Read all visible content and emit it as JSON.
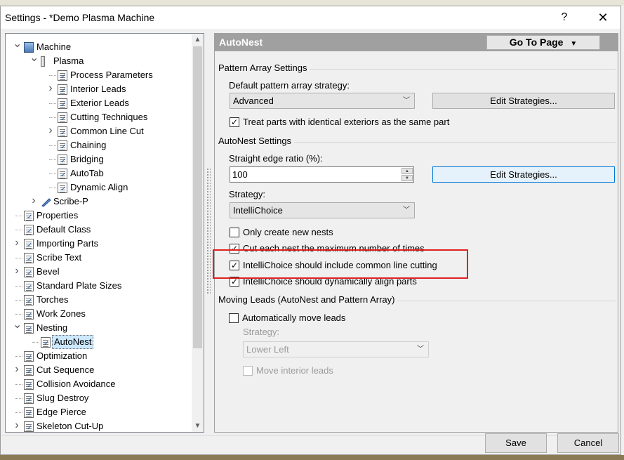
{
  "window": {
    "title": "Settings - *Demo Plasma Machine",
    "help_label": "?",
    "close_label": "✕"
  },
  "tree": {
    "items": [
      {
        "label": "Machine",
        "level": 0,
        "expander": "down",
        "icon": "machine-icon"
      },
      {
        "label": "Plasma",
        "level": 1,
        "expander": "down",
        "icon": "plasma-torch-icon"
      },
      {
        "label": "Process Parameters",
        "level": 2,
        "expander": "",
        "icon": "page-icon"
      },
      {
        "label": "Interior Leads",
        "level": 2,
        "expander": "right",
        "icon": "page-icon"
      },
      {
        "label": "Exterior Leads",
        "level": 2,
        "expander": "",
        "icon": "page-icon"
      },
      {
        "label": "Cutting Techniques",
        "level": 2,
        "expander": "",
        "icon": "page-icon"
      },
      {
        "label": "Common Line Cut",
        "level": 2,
        "expander": "right",
        "icon": "page-icon"
      },
      {
        "label": "Chaining",
        "level": 2,
        "expander": "",
        "icon": "page-icon"
      },
      {
        "label": "Bridging",
        "level": 2,
        "expander": "",
        "icon": "page-icon"
      },
      {
        "label": "AutoTab",
        "level": 2,
        "expander": "",
        "icon": "page-icon"
      },
      {
        "label": "Dynamic Align",
        "level": 2,
        "expander": "",
        "icon": "page-icon"
      },
      {
        "label": "Scribe-P",
        "level": 1,
        "expander": "right",
        "icon": "scribe-pen-icon"
      },
      {
        "label": "Properties",
        "level": 0,
        "expander": "",
        "icon": "page-icon"
      },
      {
        "label": "Default Class",
        "level": 0,
        "expander": "",
        "icon": "page-icon"
      },
      {
        "label": "Importing Parts",
        "level": 0,
        "expander": "right",
        "icon": "page-icon"
      },
      {
        "label": "Scribe Text",
        "level": 0,
        "expander": "",
        "icon": "page-icon"
      },
      {
        "label": "Bevel",
        "level": 0,
        "expander": "right",
        "icon": "page-icon"
      },
      {
        "label": "Standard Plate Sizes",
        "level": 0,
        "expander": "",
        "icon": "page-icon"
      },
      {
        "label": "Torches",
        "level": 0,
        "expander": "",
        "icon": "page-icon"
      },
      {
        "label": "Work Zones",
        "level": 0,
        "expander": "",
        "icon": "page-icon"
      },
      {
        "label": "Nesting",
        "level": 0,
        "expander": "down",
        "icon": "page-icon"
      },
      {
        "label": "AutoNest",
        "level": 1,
        "expander": "",
        "icon": "page-icon",
        "selected": true
      },
      {
        "label": "Optimization",
        "level": 0,
        "expander": "",
        "icon": "page-icon"
      },
      {
        "label": "Cut Sequence",
        "level": 0,
        "expander": "right",
        "icon": "page-icon"
      },
      {
        "label": "Collision Avoidance",
        "level": 0,
        "expander": "",
        "icon": "page-icon"
      },
      {
        "label": "Slug Destroy",
        "level": 0,
        "expander": "",
        "icon": "page-icon"
      },
      {
        "label": "Edge Pierce",
        "level": 0,
        "expander": "",
        "icon": "page-icon"
      },
      {
        "label": "Skeleton Cut-Up",
        "level": 0,
        "expander": "right",
        "icon": "page-icon"
      }
    ]
  },
  "panel": {
    "title": "AutoNest",
    "goto_label": "Go To Page",
    "pattern_section": {
      "title": "Pattern Array Settings",
      "strategy_label": "Default pattern array strategy:",
      "strategy_value": "Advanced",
      "edit_strategies_label": "Edit Strategies...",
      "identical_exteriors_label": "Treat parts with identical exteriors as the same part",
      "identical_exteriors_checked": true
    },
    "autonest_section": {
      "title": "AutoNest Settings",
      "ratio_label": "Straight edge ratio (%):",
      "ratio_value": "100",
      "edit_strategies_label": "Edit Strategies...",
      "strategy_label": "Strategy:",
      "strategy_value": "IntelliChoice",
      "only_new_label": "Only create new nests",
      "only_new_checked": false,
      "cut_each_label": "Cut each nest the maximum number of times",
      "cut_each_checked": true,
      "common_line_label": "IntelliChoice should include common line cutting",
      "common_line_checked": true,
      "dynamic_align_label": "IntelliChoice should dynamically align parts",
      "dynamic_align_checked": true
    },
    "moving_section": {
      "title": "Moving Leads (AutoNest and Pattern Array)",
      "auto_move_label": "Automatically move leads",
      "auto_move_checked": false,
      "strategy_label": "Strategy:",
      "strategy_value": "Lower Left",
      "move_interior_label": "Move interior leads",
      "move_interior_checked": false
    }
  },
  "footer": {
    "save_label": "Save",
    "cancel_label": "Cancel"
  },
  "colors": {
    "header_bar": "#a0a0a0",
    "highlight_box": "#e02020",
    "focus_border": "#0078d7",
    "selection": "#cce8ff"
  }
}
